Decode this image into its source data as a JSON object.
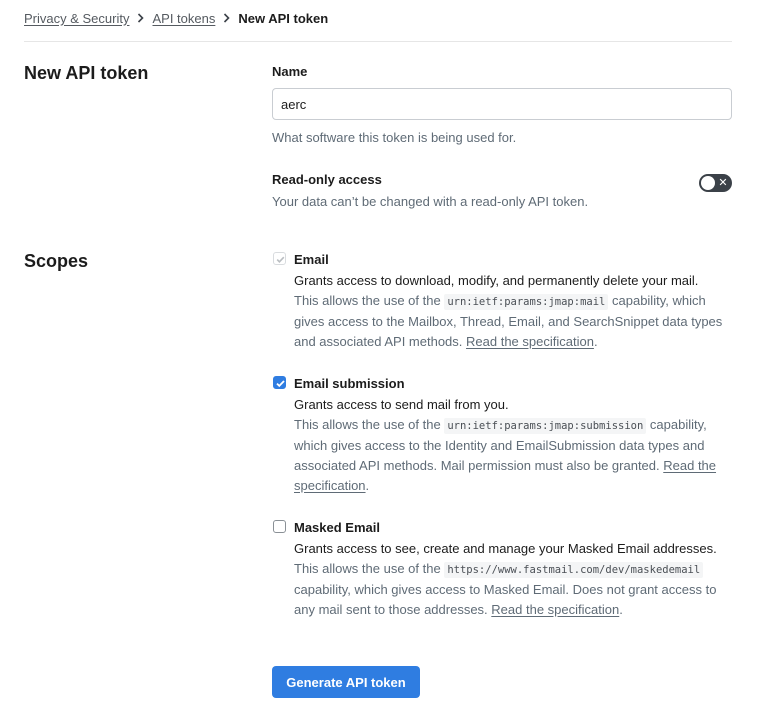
{
  "breadcrumb": {
    "items": [
      "Privacy & Security",
      "API tokens"
    ],
    "current": "New API token"
  },
  "form": {
    "section_title": "New API token",
    "name_label": "Name",
    "name_value": "aerc",
    "name_hint": "What software this token is being used for.",
    "readonly_label": "Read-only access",
    "readonly_hint": "Your data can’t be changed with a read-only API token.",
    "readonly_enabled": false
  },
  "scopes": {
    "section_title": "Scopes",
    "allows_prefix": "This allows the use of the",
    "link_text": "Read the specification",
    "items": [
      {
        "title": "Email",
        "state": "checked-disabled",
        "grants": "Grants access to download, modify, and permanently delete your mail.",
        "capability": "urn:ietf:params:jmap:mail",
        "suffix": "capability, which gives access to the Mailbox, Thread, Email, and SearchSnippet data types and associated API methods."
      },
      {
        "title": "Email submission",
        "state": "checked",
        "grants": "Grants access to send mail from you.",
        "capability": "urn:ietf:params:jmap:submission",
        "suffix": "capability, which gives access to the Identity and EmailSubmission data types and associated API methods. Mail permission must also be granted."
      },
      {
        "title": "Masked Email",
        "state": "unchecked",
        "grants": "Grants access to see, create and manage your Masked Email addresses.",
        "capability": "https://www.fastmail.com/dev/maskedemail",
        "suffix": "capability, which gives access to Masked Email. Does not grant access to any mail sent to those addresses."
      }
    ]
  },
  "actions": {
    "generate_label": "Generate API token"
  },
  "colors": {
    "accent": "#2f7de1",
    "toggle_off": "#3b4148",
    "muted_text": "#5f6b76"
  }
}
